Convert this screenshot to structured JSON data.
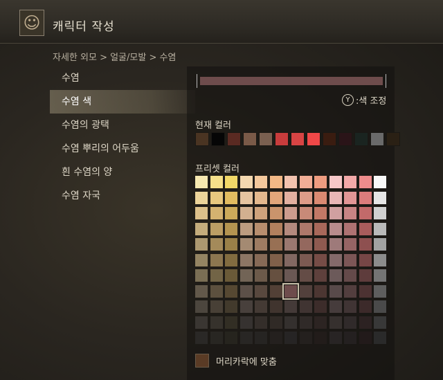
{
  "header": {
    "title": "캐릭터 작성",
    "avatar_icon": "character-portrait-icon"
  },
  "breadcrumb": "자세한 외모 > 얼굴/모발 > 수염",
  "menu": {
    "items": [
      {
        "label": "수염",
        "selected": false
      },
      {
        "label": "수염 색",
        "selected": true
      },
      {
        "label": "수염의 광택",
        "selected": false
      },
      {
        "label": "수염 뿌리의 어두움",
        "selected": false
      },
      {
        "label": "흰 수염의 양",
        "selected": false
      },
      {
        "label": "수염 자국",
        "selected": false
      }
    ]
  },
  "color_bar": {
    "value_color": "#6e4c4c"
  },
  "adjust": {
    "button_icon": "Y",
    "label": ":색 조정"
  },
  "current_color": {
    "label": "현재 컬러",
    "swatches": [
      "#4a3422",
      "#060606",
      "#5a2a22",
      "#7a5a48",
      "#7a6050",
      "#c83c3c",
      "#d84444",
      "#f04848",
      "#3a1c10",
      "#2a1418",
      "#1a2420",
      "#6a6a6a",
      "#2a2014"
    ]
  },
  "preset_color": {
    "label": "프리셋 컬러",
    "rows": [
      [
        "#f6e8b0",
        "#f6e08a",
        "#f2d868",
        "#f4d8b0",
        "#f4c89c",
        "#f2b886",
        "#f2c2ae",
        "#f2ae96",
        "#ee9c80",
        "#f6c8c8",
        "#f2a8a8",
        "#ee8c8c",
        "#f8f8f8"
      ],
      [
        "#ecd49a",
        "#e8c87e",
        "#e2bc60",
        "#e6c4a0",
        "#e4b88e",
        "#e2a67a",
        "#e2b0a0",
        "#de9c88",
        "#da8a72",
        "#e8b6b6",
        "#e29696",
        "#dc7c7c",
        "#e6e6e6"
      ],
      [
        "#dcc08a",
        "#d4b270",
        "#ccaa5a",
        "#d2b090",
        "#cea27c",
        "#ca946c",
        "#cc9c8e",
        "#c88a78",
        "#c27866",
        "#d0a0a0",
        "#c88484",
        "#c26a6a",
        "#d0d0d0"
      ],
      [
        "#c4ac7c",
        "#bc9e64",
        "#b49450",
        "#bc9c80",
        "#b88e6e",
        "#b2805e",
        "#b48a7e",
        "#ae786a",
        "#a8685a",
        "#b88c8c",
        "#ae7272",
        "#a85c5c",
        "#bababa"
      ],
      [
        "#ac9870",
        "#a48a5a",
        "#9a8048",
        "#a48a72",
        "#9e7c62",
        "#987054",
        "#9a7870",
        "#94685e",
        "#8e5a50",
        "#9e7a7a",
        "#966464",
        "#8e5050",
        "#a2a2a2"
      ],
      [
        "#948462",
        "#8c7650",
        "#826c40",
        "#8c7664",
        "#866a56",
        "#80604a",
        "#826862",
        "#7c5a52",
        "#764c46",
        "#846a6a",
        "#7c5656",
        "#764646",
        "#8c8c8c"
      ],
      [
        "#7a6e54",
        "#726446",
        "#6a5a38",
        "#726456",
        "#6c5a4a",
        "#665040",
        "#6a5854",
        "#644c46",
        "#5e403c",
        "#6c5a5a",
        "#644a4a",
        "#5e3c3c",
        "#747474"
      ],
      [
        "#62584a",
        "#5c503e",
        "#564832",
        "#5c5048",
        "#58483e",
        "#524036",
        "#6e4c4c",
        "#52403c",
        "#4c3632",
        "#584a4a",
        "#523e3e",
        "#4c3232",
        "#5e5e5e"
      ],
      [
        "#4c463e",
        "#484036",
        "#423a2c",
        "#48403c",
        "#443a34",
        "#40342e",
        "#443a38",
        "#403432",
        "#3c2c2a",
        "#463c3c",
        "#403434",
        "#3c2a2a",
        "#4a4a4a"
      ],
      [
        "#3a3632",
        "#36322c",
        "#322e24",
        "#363230",
        "#342e2a",
        "#302a26",
        "#34302e",
        "#302a28",
        "#2c2422",
        "#36302e",
        "#302a2a",
        "#2c2222",
        "#383838"
      ],
      [
        "#2a2826",
        "#282622",
        "#26241e",
        "#282624",
        "#262422",
        "#24201e",
        "#262424",
        "#24201e",
        "#221c1a",
        "#282424",
        "#242020",
        "#221a1a",
        "#2a2a2a"
      ]
    ],
    "selected": [
      7,
      6
    ]
  },
  "match_hair": {
    "label": "머리카락에 맞춤",
    "swatch_color": "#5a3b25"
  }
}
